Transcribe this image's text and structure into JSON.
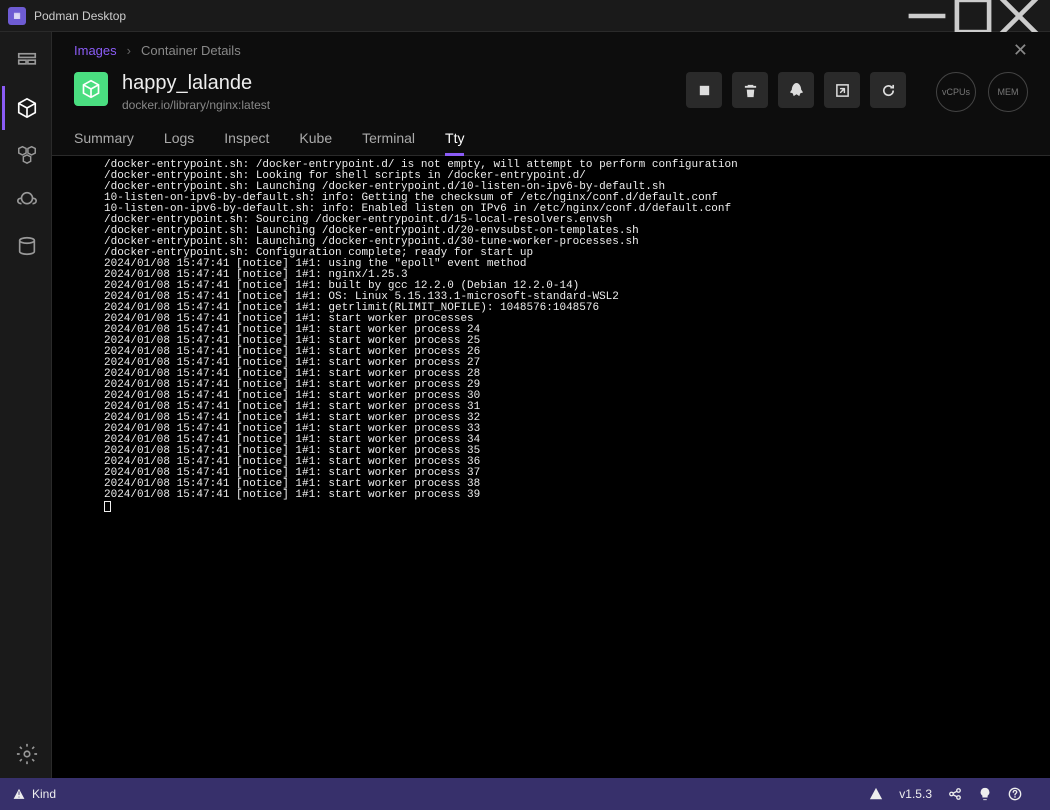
{
  "titlebar": {
    "app_name": "Podman Desktop"
  },
  "breadcrumb": {
    "root": "Images",
    "current": "Container Details"
  },
  "container": {
    "name": "happy_lalande",
    "image": "docker.io/library/nginx:latest"
  },
  "meters": {
    "vcpus": "vCPUs",
    "mem": "MEM"
  },
  "tabs": {
    "summary": "Summary",
    "logs": "Logs",
    "inspect": "Inspect",
    "kube": "Kube",
    "terminal": "Terminal",
    "tty": "Tty"
  },
  "terminal_lines": [
    "/docker-entrypoint.sh: /docker-entrypoint.d/ is not empty, will attempt to perform configuration",
    "/docker-entrypoint.sh: Looking for shell scripts in /docker-entrypoint.d/",
    "/docker-entrypoint.sh: Launching /docker-entrypoint.d/10-listen-on-ipv6-by-default.sh",
    "10-listen-on-ipv6-by-default.sh: info: Getting the checksum of /etc/nginx/conf.d/default.conf",
    "10-listen-on-ipv6-by-default.sh: info: Enabled listen on IPv6 in /etc/nginx/conf.d/default.conf",
    "/docker-entrypoint.sh: Sourcing /docker-entrypoint.d/15-local-resolvers.envsh",
    "/docker-entrypoint.sh: Launching /docker-entrypoint.d/20-envsubst-on-templates.sh",
    "/docker-entrypoint.sh: Launching /docker-entrypoint.d/30-tune-worker-processes.sh",
    "/docker-entrypoint.sh: Configuration complete; ready for start up",
    "2024/01/08 15:47:41 [notice] 1#1: using the \"epoll\" event method",
    "2024/01/08 15:47:41 [notice] 1#1: nginx/1.25.3",
    "2024/01/08 15:47:41 [notice] 1#1: built by gcc 12.2.0 (Debian 12.2.0-14)",
    "2024/01/08 15:47:41 [notice] 1#1: OS: Linux 5.15.133.1-microsoft-standard-WSL2",
    "2024/01/08 15:47:41 [notice] 1#1: getrlimit(RLIMIT_NOFILE): 1048576:1048576",
    "2024/01/08 15:47:41 [notice] 1#1: start worker processes",
    "2024/01/08 15:47:41 [notice] 1#1: start worker process 24",
    "2024/01/08 15:47:41 [notice] 1#1: start worker process 25",
    "2024/01/08 15:47:41 [notice] 1#1: start worker process 26",
    "2024/01/08 15:47:41 [notice] 1#1: start worker process 27",
    "2024/01/08 15:47:41 [notice] 1#1: start worker process 28",
    "2024/01/08 15:47:41 [notice] 1#1: start worker process 29",
    "2024/01/08 15:47:41 [notice] 1#1: start worker process 30",
    "2024/01/08 15:47:41 [notice] 1#1: start worker process 31",
    "2024/01/08 15:47:41 [notice] 1#1: start worker process 32",
    "2024/01/08 15:47:41 [notice] 1#1: start worker process 33",
    "2024/01/08 15:47:41 [notice] 1#1: start worker process 34",
    "2024/01/08 15:47:41 [notice] 1#1: start worker process 35",
    "2024/01/08 15:47:41 [notice] 1#1: start worker process 36",
    "2024/01/08 15:47:41 [notice] 1#1: start worker process 37",
    "2024/01/08 15:47:41 [notice] 1#1: start worker process 38",
    "2024/01/08 15:47:41 [notice] 1#1: start worker process 39"
  ],
  "statusbar": {
    "kind": "Kind",
    "version": "v1.5.3"
  }
}
